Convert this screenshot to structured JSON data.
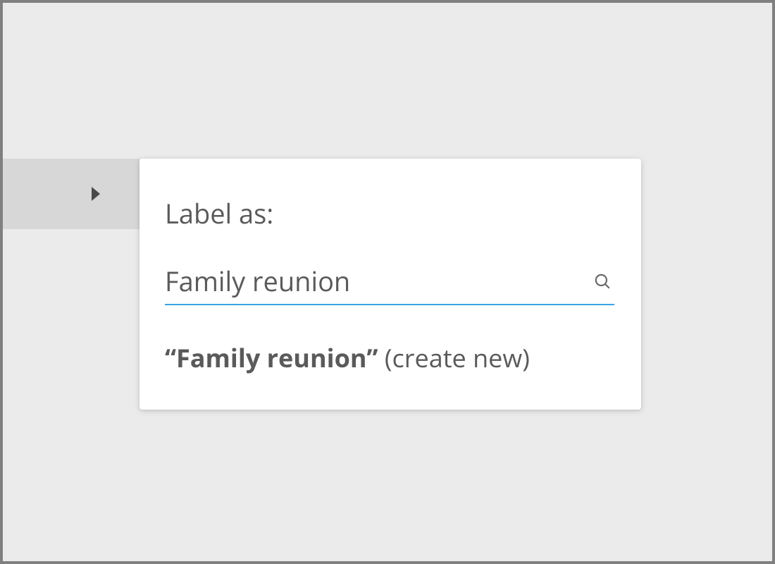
{
  "popover": {
    "title": "Label as:",
    "search": {
      "value": "Family reunion"
    },
    "create_new": {
      "quoted_name": "“Family reunion”",
      "suffix": " (create new)"
    }
  }
}
